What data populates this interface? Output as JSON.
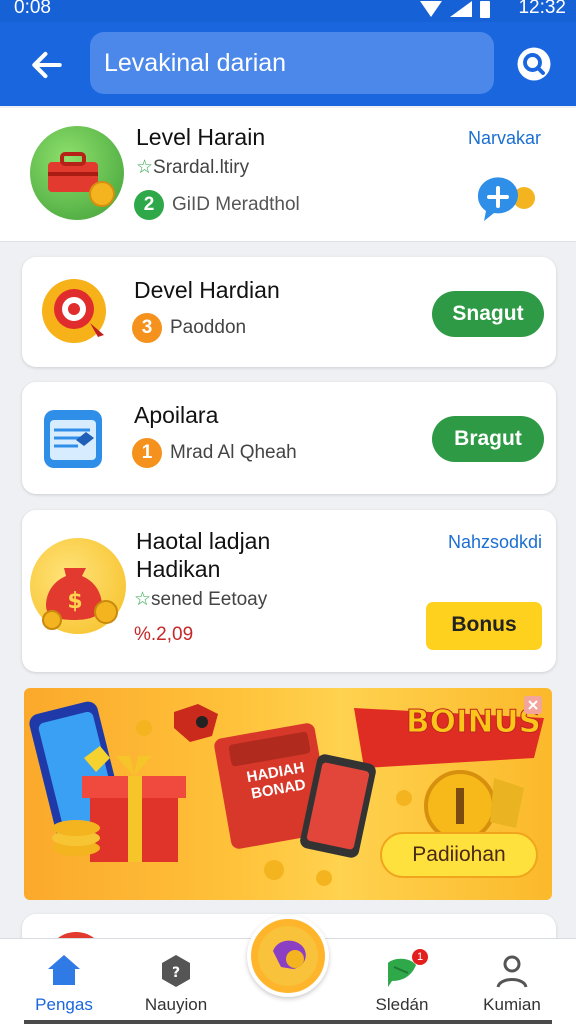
{
  "status": {
    "time": "0:08",
    "time_right": "12:32"
  },
  "appbar": {
    "search_value": "Levakinal darian"
  },
  "top_item": {
    "title": "Level Harain",
    "subtitle": "Srardal.ltiry",
    "badge": "2",
    "meta": "GiID Meradthol",
    "link": "Narvakar"
  },
  "cards": [
    {
      "title": "Devel Hardian",
      "badge": "3",
      "meta": "Paoddon",
      "button": "Snagut"
    },
    {
      "title": "Apoilara",
      "badge": "1",
      "meta": "Mrad Al Qheah",
      "button": "Bragut"
    },
    {
      "title_line1": "Haotal ladjan",
      "title_line2": "Hadikan",
      "subtitle": "sened Eetoay",
      "price": "%.2,09",
      "link": "Nahzsodkdi",
      "button": "Bonus"
    }
  ],
  "banner": {
    "headline": "BOINUS",
    "bag_text": "HADIAH BONAD",
    "cta": "Padiiohan"
  },
  "nav": {
    "items": [
      {
        "label": "Pengas"
      },
      {
        "label": "Nauyion"
      },
      {
        "label": "Sledán",
        "badge": "1"
      },
      {
        "label": "Kumian"
      }
    ]
  },
  "colors": {
    "primary": "#1a66de",
    "green": "#2e9a45",
    "yellow": "#ffd11f",
    "orange": "#f5921e"
  },
  "icons": [
    "back-arrow-icon",
    "search-icon",
    "chat-add-icon",
    "home-icon",
    "hexagon-icon",
    "gift-fab-icon",
    "chat-leaf-icon",
    "profile-icon"
  ]
}
